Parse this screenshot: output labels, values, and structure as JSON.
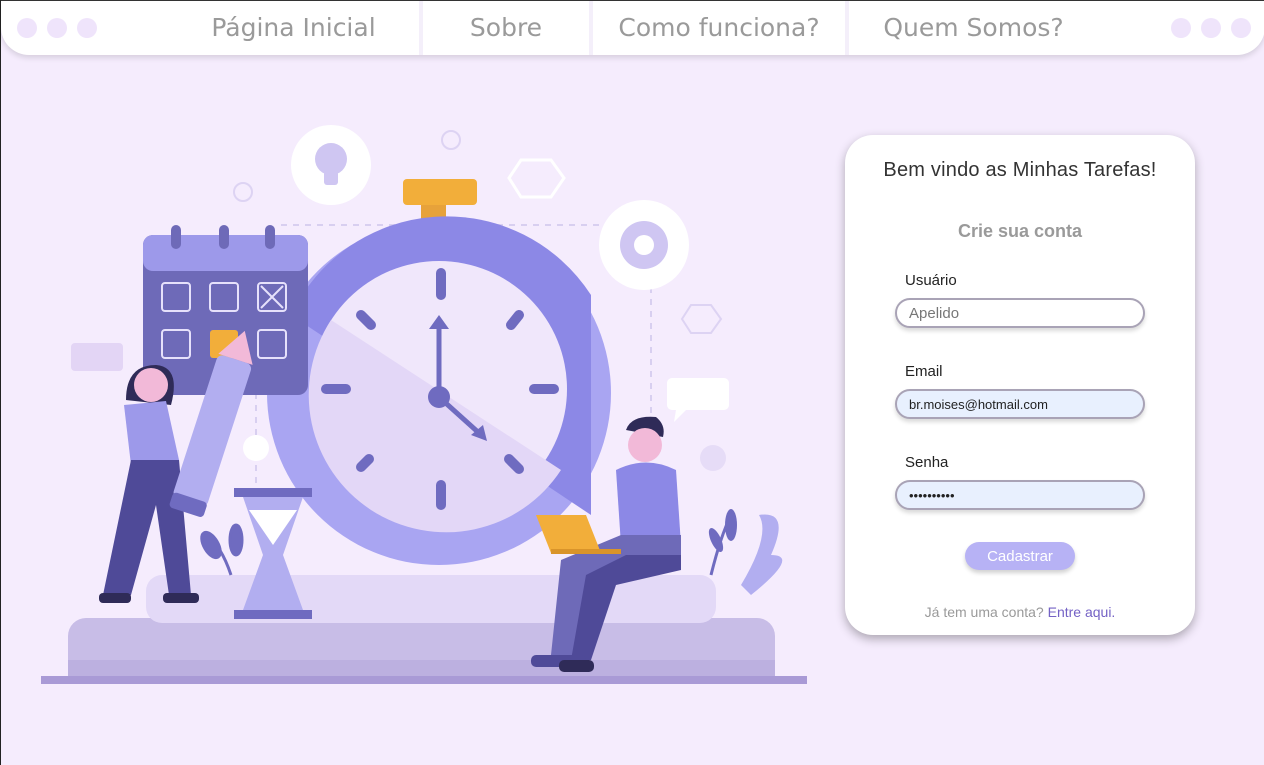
{
  "nav": {
    "items": [
      "Página Inicial",
      "Sobre",
      "Como funciona?",
      "Quem Somos?"
    ]
  },
  "form": {
    "title": "Bem vindo as Minhas Tarefas!",
    "subtitle": "Crie sua conta",
    "username": {
      "label": "Usuário",
      "placeholder": "Apelido",
      "value": ""
    },
    "email": {
      "label": "Email",
      "value": "br.moises@hotmail.com"
    },
    "password": {
      "label": "Senha",
      "value": "••••••••••"
    },
    "submit_label": "Cadastrar",
    "login_prompt": "Já tem uma conta?",
    "login_link": "Entre aqui."
  },
  "colors": {
    "background": "#f5ecfd",
    "accent": "#b7b2f5",
    "link": "#7462c5",
    "illustration_primary": "#8f8ae6",
    "illustration_yellow": "#f2ae3a"
  }
}
